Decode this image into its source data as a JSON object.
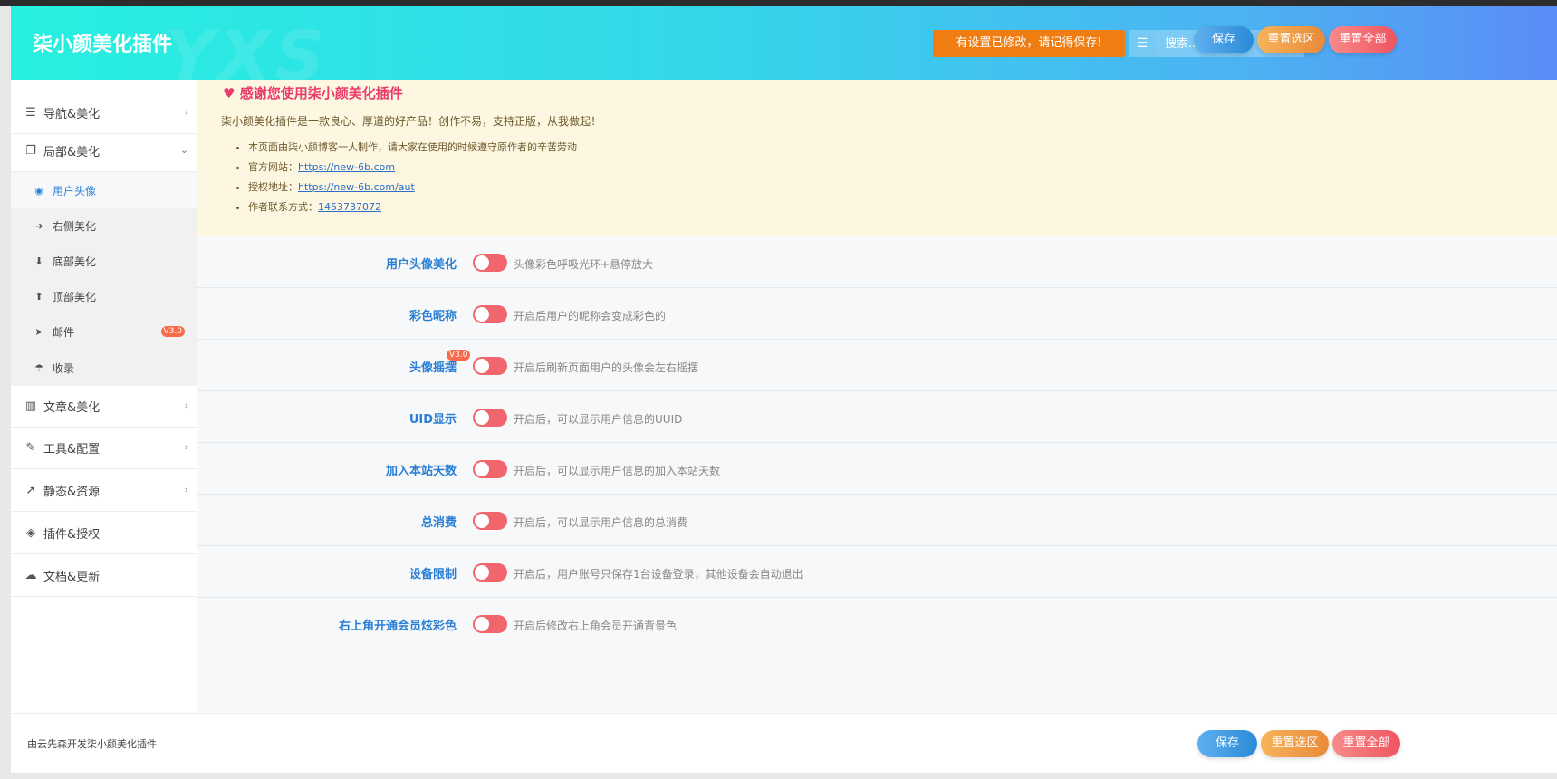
{
  "header": {
    "watermark": "YXS",
    "brand": "柒小颜美化插件",
    "notice": "有设置已修改，请记得保存!",
    "menu_icon": "list-icon",
    "search_placeholder": "搜索...",
    "save": "保存",
    "reset_section": "重置选区",
    "reset_all": "重置全部"
  },
  "sidebar": {
    "items": [
      {
        "label": "导航&美化",
        "icon": "list-icon",
        "glyph": "☰",
        "arrow": "›"
      },
      {
        "label": "局部&美化",
        "icon": "copy-icon",
        "glyph": "❐",
        "arrow": "⌄"
      },
      {
        "label": "文章&美化",
        "icon": "map-icon",
        "glyph": "▥",
        "arrow": "›"
      },
      {
        "label": "工具&配置",
        "icon": "wrench-icon",
        "glyph": "✎",
        "arrow": "›"
      },
      {
        "label": "静态&资源",
        "icon": "rocket-icon",
        "glyph": "➚",
        "arrow": "›"
      },
      {
        "label": "插件&授权",
        "icon": "gitlab-icon",
        "glyph": "◈",
        "arrow": ""
      },
      {
        "label": "文档&更新",
        "icon": "cloud-upload-icon",
        "glyph": "☁",
        "arrow": ""
      }
    ],
    "sub_items": [
      {
        "label": "用户头像",
        "icon": "user-circle-icon",
        "glyph": "◉"
      },
      {
        "label": "右侧美化",
        "icon": "arrow-circle-right-icon",
        "glyph": "➔"
      },
      {
        "label": "底部美化",
        "icon": "arrow-circle-down-icon",
        "glyph": "⬇"
      },
      {
        "label": "顶部美化",
        "icon": "arrow-circle-up-icon",
        "glyph": "⬆"
      },
      {
        "label": "邮件",
        "icon": "telegram-icon",
        "glyph": "➤",
        "badge": "V3.0"
      },
      {
        "label": "收录",
        "icon": "umbrella-icon",
        "glyph": "☂"
      }
    ]
  },
  "banner": {
    "title_icon": "heart-icon",
    "title": "感谢您使用柒小颜美化插件",
    "desc": "柒小颜美化插件是一款良心、厚道的好产品！创作不易，支持正版，从我做起！",
    "line1": "本页面由柒小颜博客一人制作，请大家在使用的时候遵守原作者的辛苦劳动",
    "site_label": "官方网站：",
    "site_url": "https://new-6b.com",
    "auth_label": "授权地址：",
    "auth_url": "https://new-6b.com/aut",
    "contact_label": "作者联系方式：",
    "contact": "1453737072"
  },
  "settings": [
    {
      "label": "用户头像美化",
      "hint": "头像彩色呼吸光环+悬停放大",
      "on": false
    },
    {
      "label": "彩色昵称",
      "hint": "开启后用户的昵称会变成彩色的",
      "on": false
    },
    {
      "label": "头像摇摆",
      "hint": "开启后刷新页面用户的头像会左右摇摆",
      "on": false,
      "badge": "V3.0"
    },
    {
      "label": "UID显示",
      "hint": "开启后，可以显示用户信息的UUID",
      "on": false
    },
    {
      "label": "加入本站天数",
      "hint": "开启后，可以显示用户信息的加入本站天数",
      "on": false
    },
    {
      "label": "总消费",
      "hint": "开启后，可以显示用户信息的总消费",
      "on": false
    },
    {
      "label": "设备限制",
      "hint": "开启后，用户账号只保存1台设备登录，其他设备会自动退出",
      "on": false
    },
    {
      "label": "右上角开通会员炫彩色",
      "hint": "开启后修改右上角会员开通背景色",
      "on": false
    }
  ],
  "footer": {
    "credit": "由云先森开发柒小颜美化插件",
    "save": "保存",
    "reset_section": "重置选区",
    "reset_all": "重置全部"
  },
  "colors": {
    "accent": "#2a7fd4",
    "toggle_off": "#f0666c",
    "notice": "#f07d12",
    "banner_bg": "#fdf6e0",
    "heart": "#ea3b6a"
  }
}
